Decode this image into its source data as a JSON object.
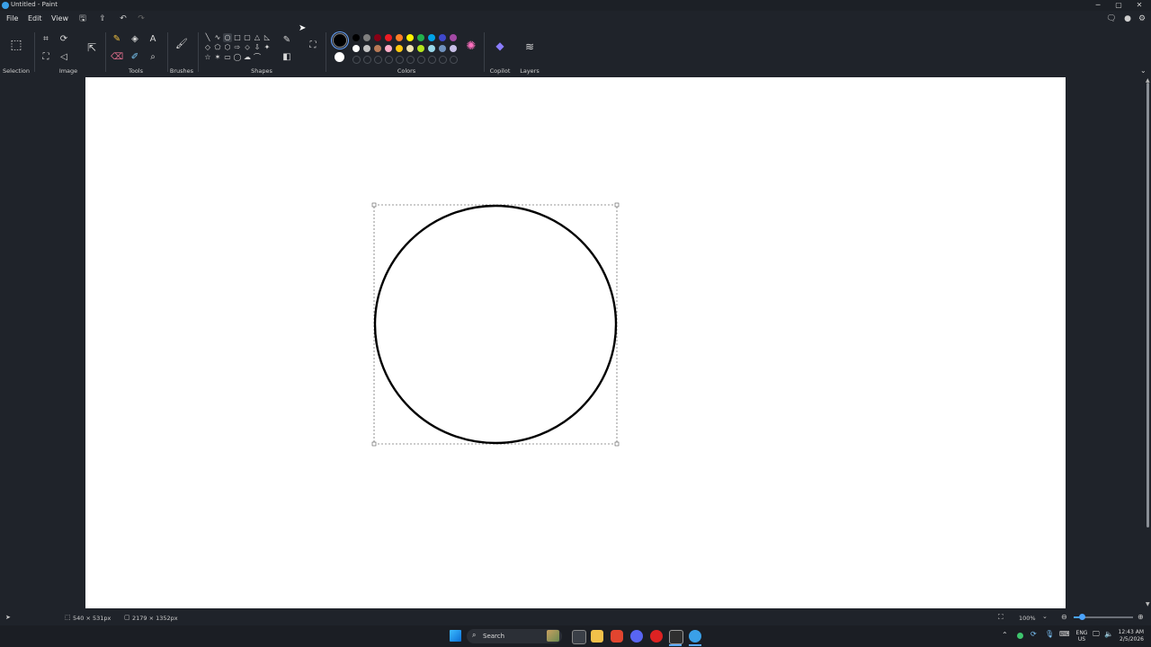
{
  "window": {
    "title": "Untitled - Paint",
    "controls": {
      "minimize": "─",
      "maximize": "▢",
      "close": "✕"
    }
  },
  "menu": {
    "file": "File",
    "edit": "Edit",
    "view": "View"
  },
  "quick_access": {
    "save": "🖫",
    "share": "⇪",
    "undo": "↶",
    "redo": "↷"
  },
  "header_right": {
    "comment": "🗨",
    "account": "●",
    "settings": "⚙"
  },
  "ribbon": {
    "groups": {
      "selection": "Selection",
      "image": "Image",
      "tools": "Tools",
      "brushes": "Brushes",
      "shapes": "Shapes",
      "colors": "Colors",
      "copilot": "Copilot",
      "layers": "Layers"
    },
    "icons": {
      "selection": "⬚",
      "crop": "⌗",
      "rotate": "⟳",
      "resize": "⇱",
      "flip": "◁",
      "background": "⛶",
      "pencil": "✎",
      "fill": "◈",
      "text": "A",
      "eraser": "⌫",
      "color_picker": "✐",
      "magnifier": "⌕",
      "brush": "🖌",
      "outline": "✎",
      "shape_fill": "◧",
      "copilot": "◆",
      "layers": "≋",
      "color_picker_wheel": "✺"
    },
    "shapes": [
      "╲",
      "∿",
      "○",
      "□",
      "▢",
      "△",
      "◺",
      "◇",
      "⬠",
      "⬡",
      "⇨",
      "⬦",
      "⇩",
      "✦",
      "☆",
      "✶",
      "▭",
      "◯",
      "☁",
      "⌒"
    ],
    "colors_row1": [
      "#000000",
      "#7f7f7f",
      "#880015",
      "#ed1c24",
      "#ff7f27",
      "#fff200",
      "#22b14c",
      "#00a2e8",
      "#3f48cc",
      "#a349a4"
    ],
    "colors_row2": [
      "#ffffff",
      "#c3c3c3",
      "#b97a57",
      "#ffaec9",
      "#ffc90e",
      "#efe4b0",
      "#b5e61d",
      "#99d9ea",
      "#7092be",
      "#c8bfe7"
    ],
    "primary_color": "#000000",
    "secondary_color": "#ffffff"
  },
  "status": {
    "selection_size": "540 × 531px",
    "canvas_size": "2179 × 1352px",
    "zoom": "100%",
    "zoom_fit_icon": "⛶",
    "zoom_out": "⊖",
    "zoom_in": "⊕"
  },
  "taskbar": {
    "search_placeholder": "Search",
    "language": "ENG",
    "region": "US",
    "time": "12:43 AM",
    "date": "2/5/2026",
    "tray_chevron": "⌃"
  }
}
